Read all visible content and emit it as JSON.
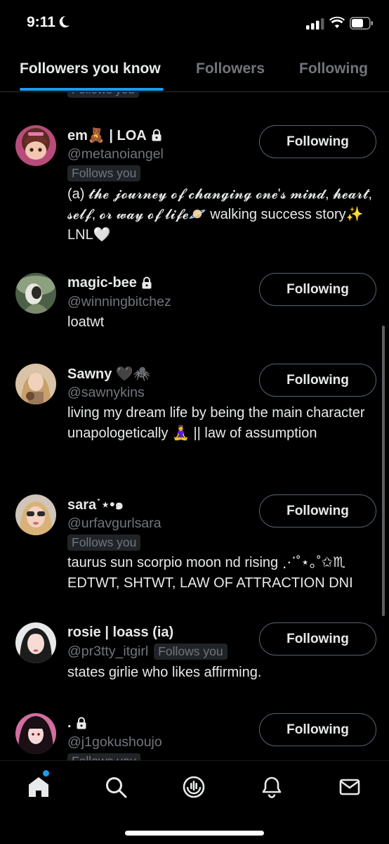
{
  "status_bar": {
    "time": "9:11"
  },
  "tabs": [
    {
      "label": "Followers you know",
      "active": true
    },
    {
      "label": "Followers",
      "active": false
    },
    {
      "label": "Following",
      "active": false
    }
  ],
  "top_partial_badge": "Follows you",
  "users": [
    {
      "name": "em🧸 | LOA",
      "handle": "@metanoiangel",
      "locked": true,
      "follows_you": "Follows you",
      "bio": "(a) 𝓽𝓱𝓮 𝓳𝓸𝓾𝓻𝓷𝓮𝔂 𝓸𝓯 𝓬𝓱𝓪𝓷𝓰𝓲𝓷𝓰 𝓸𝓷𝓮'𝓼 𝓶𝓲𝓷𝓭, 𝓱𝓮𝓪𝓻𝓽, 𝓼𝓮𝓵𝓯, 𝓸𝓻 𝔀𝓪𝔂 𝓸𝓯 𝓵𝓲𝓯𝓮🪐 walking success story✨ LNL🤍",
      "button": "Following"
    },
    {
      "name": "magic-bee",
      "handle": "@winningbitchez",
      "locked": true,
      "follows_you": "",
      "bio": "loatwt",
      "button": "Following"
    },
    {
      "name": "Sawny 🖤🕷️",
      "handle": "@sawnykins",
      "locked": false,
      "follows_you": "",
      "bio": "living my dream life by being the main character unapologetically 🧘‍♀️ || law of assumption",
      "button": "Following"
    },
    {
      "name": "sara˙⋆•๑",
      "handle": "@urfavgurlsara",
      "locked": false,
      "follows_you": "Follows you",
      "bio": "taurus sun scorpio moon nd rising ⋰˚⋆｡˚✩♏︎ EDTWT, SHTWT, LAW OF ATTRACTION DNI",
      "button": "Following"
    },
    {
      "name": "rosie | loass (ia)",
      "handle": "@pr3tty_itgirl",
      "locked": false,
      "follows_you": "Follows you",
      "bio": "states girlie who likes affirming.",
      "button": "Following"
    },
    {
      "name": ".",
      "handle": "@j1gokushoujo",
      "locked": true,
      "follows_you": "Follows you",
      "bio": "",
      "button": "Following"
    }
  ],
  "bottom_nav": [
    {
      "icon": "home-icon",
      "has_notification_dot": true
    },
    {
      "icon": "search-icon"
    },
    {
      "icon": "spaces-icon"
    },
    {
      "icon": "bell-icon"
    },
    {
      "icon": "mail-icon"
    }
  ],
  "colors": {
    "accent": "#1d9bf0",
    "background": "#000000",
    "text_primary": "#e7e9ea",
    "text_secondary": "#71767b"
  }
}
